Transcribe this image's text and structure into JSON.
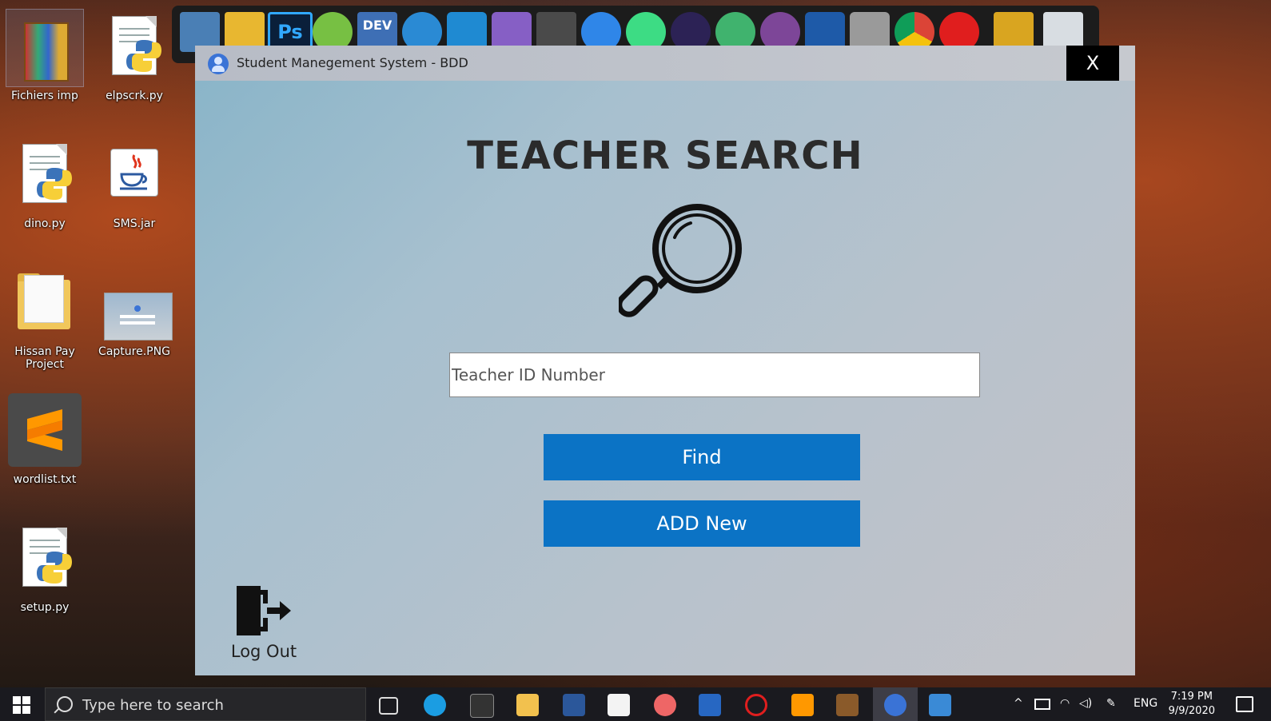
{
  "desktop": {
    "icons": [
      {
        "label": "Fichiers imp"
      },
      {
        "label": "elpscrk.py"
      },
      {
        "label": "dino.py"
      },
      {
        "label": "SMS.jar"
      },
      {
        "label": "Hissan Pay Project"
      },
      {
        "label": "Capture.PNG"
      },
      {
        "label": "wordlist.txt"
      },
      {
        "label": "setup.py"
      }
    ]
  },
  "window": {
    "title": "Student Manegement System - BDD",
    "close_label": "X",
    "heading": "TEACHER SEARCH",
    "id_placeholder": "Teacher ID Number",
    "find_label": "Find",
    "add_label": "ADD New",
    "logout_label": "Log Out"
  },
  "taskbar": {
    "search_placeholder": "Type here to search",
    "language": "ENG",
    "time": "7:19 PM",
    "date": "9/9/2020"
  },
  "colors": {
    "button_blue": "#0b73c5",
    "close_black": "#000000"
  }
}
